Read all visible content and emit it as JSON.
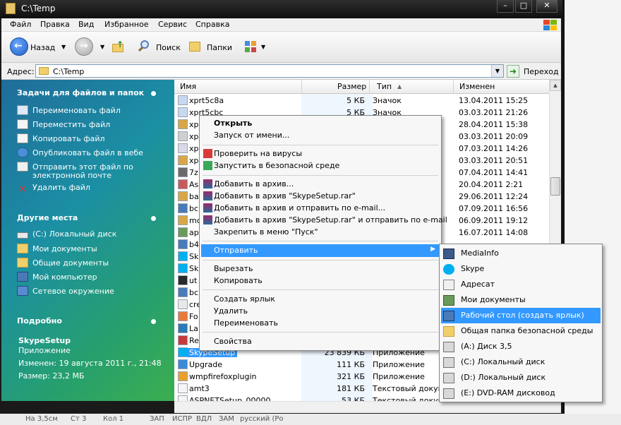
{
  "window": {
    "title": "C:\\Temp"
  },
  "menu": [
    "Файл",
    "Правка",
    "Вид",
    "Избранное",
    "Сервис",
    "Справка"
  ],
  "toolbar": {
    "back": "Назад",
    "search": "Поиск",
    "folders": "Папки"
  },
  "address": {
    "label": "Адрес:",
    "value": "C:\\Temp",
    "go": "Переход"
  },
  "left": {
    "tasks_title": "Задачи для файлов и папок",
    "tasks": [
      "Переименовать файл",
      "Переместить файл",
      "Копировать файл",
      "Опубликовать файл в вебе",
      "Отправить этот файл по",
      "электронной почте",
      "Удалить файл"
    ],
    "places_title": "Другие места",
    "places": [
      "(C:) Локальный диск",
      "Мои документы",
      "Общие документы",
      "Мой компьютер",
      "Сетевое окружение"
    ],
    "details_title": "Подробно",
    "details_name": "SkypeSetup",
    "details_type": "Приложение",
    "details_modified": "Изменен: 19 августа 2011 г., 21:48",
    "details_size": "Размер: 23,2 МБ"
  },
  "columns": {
    "name": "Имя",
    "size": "Размер",
    "type": "Тип",
    "modified": "Изменен"
  },
  "files": [
    {
      "name": "xprt5c8a",
      "size": "5 КБ",
      "type": "Значок",
      "date": "13.04.2011 15:25"
    },
    {
      "name": "xprt5cbc",
      "size": "5 КБ",
      "type": "Значок",
      "date": "03.03.2011 21:26"
    },
    {
      "name": "xp",
      "size": "",
      "type": "",
      "date": "28.04.2011 15:38"
    },
    {
      "name": "xp",
      "size": "",
      "type": "",
      "date": "03.03.2011 20:09"
    },
    {
      "name": "xp",
      "size": "",
      "type": "",
      "date": "07.03.2011 14:26"
    },
    {
      "name": "xp",
      "size": "",
      "type": "",
      "date": "03.03.2011 20:51"
    },
    {
      "name": "7z",
      "size": "",
      "type": "",
      "date": "07.04.2011 14:41"
    },
    {
      "name": "As",
      "size": "",
      "type": "",
      "date": "20.04.2011 2:21"
    },
    {
      "name": "ba",
      "size": "",
      "type": "",
      "date": "29.06.2011 12:24"
    },
    {
      "name": "bc",
      "size": "",
      "type": "",
      "date": "07.09.2011 16:56"
    },
    {
      "name": "mc",
      "size": "",
      "type": "",
      "date": "06.09.2011 19:12"
    },
    {
      "name": "ap",
      "size": "",
      "type": "el",
      "date": "16.07.2011 14:08"
    },
    {
      "name": "b4",
      "size": "",
      "type": "",
      "date": ""
    },
    {
      "name": "Sk",
      "size": "",
      "type": "",
      "date": ""
    },
    {
      "name": "Sk",
      "size": "",
      "type": "",
      "date": ""
    },
    {
      "name": "ut",
      "size": "",
      "type": "",
      "date": ""
    },
    {
      "name": "bc",
      "size": "",
      "type": "",
      "date": ""
    },
    {
      "name": "cre",
      "size": "",
      "type": "",
      "date": ""
    },
    {
      "name": "Fo",
      "size": "",
      "type": "",
      "date": ""
    },
    {
      "name": "La",
      "size": "",
      "type": "",
      "date": ""
    },
    {
      "name": "Re",
      "size": "",
      "type": "",
      "date": ""
    },
    {
      "name": "SkypeSetup",
      "size": "23 839 КБ",
      "type": "Приложение",
      "date": ""
    },
    {
      "name": "Upgrade",
      "size": "111 КБ",
      "type": "Приложение",
      "date": ""
    },
    {
      "name": "wmpfirefoxplugin",
      "size": "321 КБ",
      "type": "Приложение",
      "date": ""
    },
    {
      "name": "amt3",
      "size": "181 КБ",
      "type": "Текстовый докуме",
      "date": ""
    },
    {
      "name": "ASPNETSetup_00000",
      "size": "53 КБ",
      "type": "Текстовый докуме",
      "date": ""
    }
  ],
  "context_menu": [
    "Открыть",
    "Запуск от имени...",
    "Проверить на вирусы",
    "Запустить в безопасной среде",
    "Добавить в архив...",
    "Добавить в архив \"SkypeSetup.rar\"",
    "Добавить в архив и отправить по e-mail...",
    "Добавить в архив \"SkypeSetup.rar\" и отправить по e-mail",
    "Закрепить в меню \"Пуск\"",
    "Отправить",
    "Вырезать",
    "Копировать",
    "Создать ярлык",
    "Удалить",
    "Переименовать",
    "Свойства"
  ],
  "sendto_menu": [
    "MediaInfo",
    "Skype",
    "Адресат",
    "Мои документы",
    "Рабочий стол (создать ярлык)",
    "Общая папка безопасной среды",
    "(A:) Диск 3,5",
    "(C:) Локальный диск",
    "(D:) Локальный диск",
    "(E:) DVD-RAM дисковод"
  ],
  "bg_status": [
    "На 3,5см",
    "Ст 3",
    "Кол 1",
    "ЗАП",
    "ИСПР",
    "ВДЛ",
    "ЗАМ",
    "русский (Ро"
  ]
}
